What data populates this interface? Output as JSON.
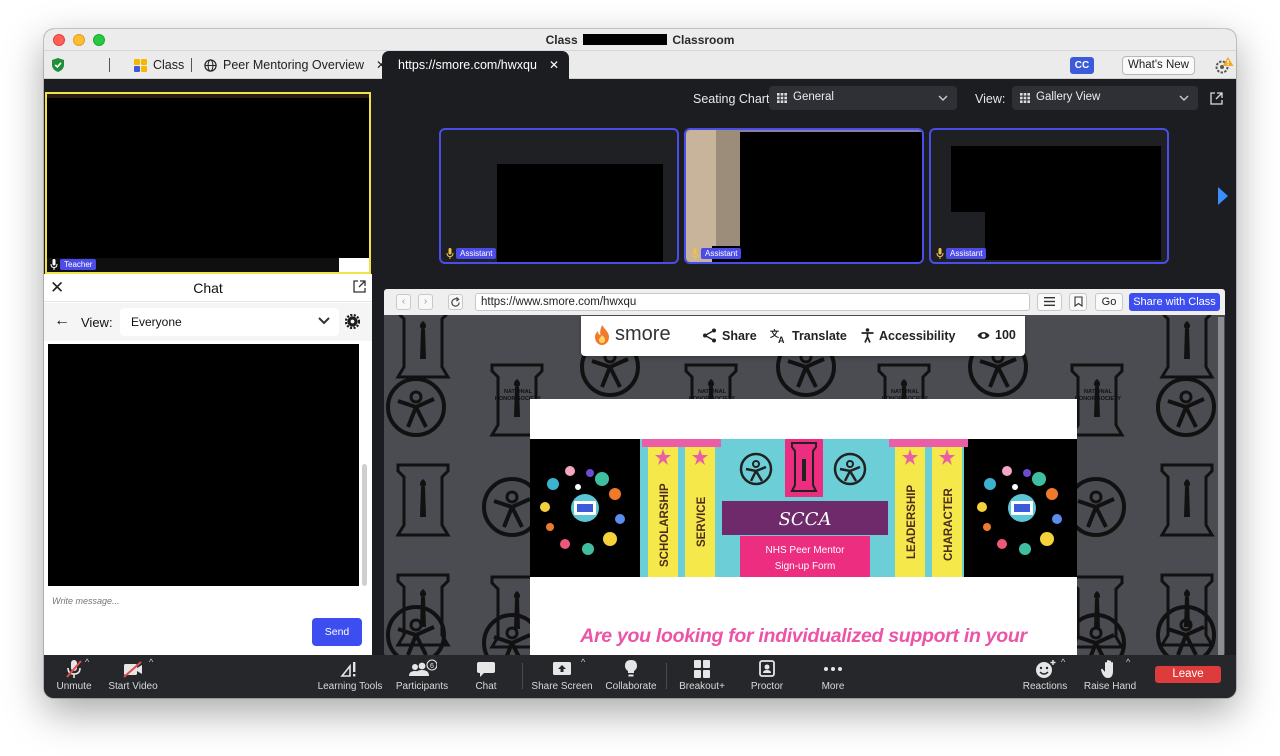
{
  "window": {
    "title_prefix": "Class",
    "title_suffix": "Classroom"
  },
  "tabs": [
    {
      "label": "Class"
    },
    {
      "label": "Peer Mentoring Overview"
    },
    {
      "label": "https://smore.com/hwxqu"
    }
  ],
  "tabbar": {
    "cc_label": "CC",
    "whats_new_label": "What's New"
  },
  "teacher": {
    "label": "Teacher"
  },
  "chat": {
    "title": "Chat",
    "view_label": "View:",
    "view_selected": "Everyone",
    "input_placeholder": "Write message...",
    "send_label": "Send"
  },
  "seating": {
    "label": "Seating Chart:",
    "selected": "General",
    "view_label": "View:",
    "view_selected": "Gallery View"
  },
  "assistants": [
    {
      "label": "Assistant"
    },
    {
      "label": "Assistant"
    },
    {
      "label": "Assistant"
    }
  ],
  "browser": {
    "url": "https://www.smore.com/hwxqu",
    "go_label": "Go",
    "share_label": "Share with Class"
  },
  "smore": {
    "logo": "smore",
    "share": "Share",
    "translate": "Translate",
    "accessibility": "Accessibility",
    "views": "100"
  },
  "emblem_text": {
    "line1": "NATIONAL",
    "line2": "HONOR SOCIETY"
  },
  "banner": {
    "pillars": [
      "SCHOLARSHIP",
      "SERVICE",
      "LEADERSHIP",
      "CHARACTER"
    ],
    "school": "SCCA",
    "subtitle_line1": "NHS Peer Mentor",
    "subtitle_line2": "Sign-up Form"
  },
  "page": {
    "headline": "Are you looking for individualized support in your"
  },
  "toolbar": {
    "unmute": "Unmute",
    "start_video": "Start Video",
    "learning_tools": "Learning Tools",
    "participants": "Participants",
    "participants_count": "6",
    "chat": "Chat",
    "share_screen": "Share Screen",
    "collaborate": "Collaborate",
    "breakout": "Breakout+",
    "proctor": "Proctor",
    "more": "More",
    "reactions": "Reactions",
    "raise_hand": "Raise Hand",
    "leave": "Leave"
  },
  "colors": {
    "accent_blue": "#3d4ef0",
    "leave_red": "#de3c3c",
    "teacher_border": "#f0e34a",
    "headline_pink": "#ec54a8"
  }
}
